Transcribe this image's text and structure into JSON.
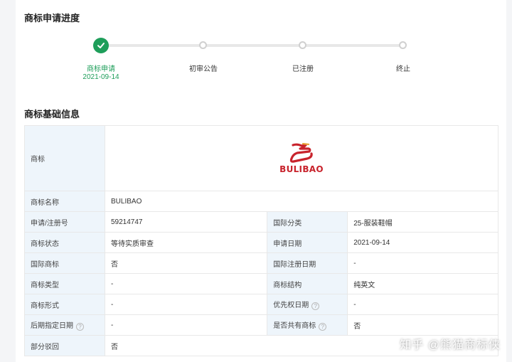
{
  "progress": {
    "title": "商标申请进度",
    "steps": [
      {
        "label": "商标申请",
        "date": "2021-09-14",
        "done": true
      },
      {
        "label": "初审公告",
        "done": false
      },
      {
        "label": "已注册",
        "done": false
      },
      {
        "label": "终止",
        "done": false
      }
    ]
  },
  "info": {
    "title": "商标基础信息",
    "logo_label": "商标",
    "logo_text": "BULIBAO",
    "name_label": "商标名称",
    "name_value": "BULIBAO",
    "rows": [
      {
        "k1": "申请/注册号",
        "v1": "59214747",
        "k2": "国际分类",
        "v2": "25-服装鞋帽"
      },
      {
        "k1": "商标状态",
        "v1": "等待实质审查",
        "k2": "申请日期",
        "v2": "2021-09-14"
      },
      {
        "k1": "国际商标",
        "v1": "否",
        "k2": "国际注册日期",
        "v2": "-"
      },
      {
        "k1": "商标类型",
        "v1": "-",
        "k2": "商标结构",
        "v2": "纯英文"
      },
      {
        "k1": "商标形式",
        "v1": "-",
        "k2": "优先权日期",
        "v2": "-"
      },
      {
        "k1": "后期指定日期",
        "v1": "-",
        "k2": "是否共有商标",
        "v2": "否"
      }
    ],
    "partial_label": "部分驳回",
    "partial_value": "否",
    "help_glyph": "?"
  },
  "watermark": "知乎 @熊猫商标侠"
}
